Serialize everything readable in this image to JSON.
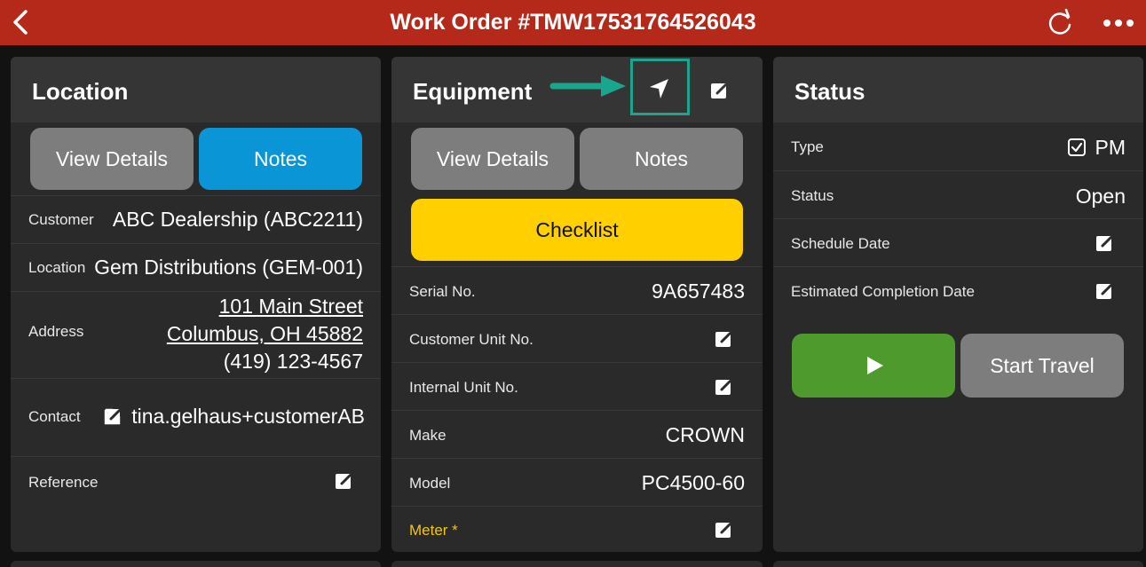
{
  "header": {
    "title": "Work Order #TMW17531764526043",
    "bg_color": "#b5291a"
  },
  "location": {
    "title": "Location",
    "tabs": {
      "details": "View Details",
      "notes": "Notes"
    },
    "customer_label": "Customer",
    "customer_value": "ABC Dealership (ABC2211)",
    "location_label": "Location",
    "location_value": "Gem Distributions (GEM-001)",
    "address_label": "Address",
    "address_line1": "101 Main Street",
    "address_line2": "Columbus, OH 45882",
    "phone": "(419) 123-4567",
    "contact_label": "Contact",
    "contact_value": "tina.gelhaus+customerAB",
    "reference_label": "Reference"
  },
  "equipment": {
    "title": "Equipment",
    "tabs": {
      "details": "View Details",
      "notes": "Notes"
    },
    "checklist": "Checklist",
    "serial_label": "Serial No.",
    "serial_value": "9A657483",
    "cust_unit_label": "Customer Unit No.",
    "internal_unit_label": "Internal Unit No.",
    "make_label": "Make",
    "make_value": "CROWN",
    "model_label": "Model",
    "model_value": "PC4500-60",
    "meter_label": "Meter *"
  },
  "status": {
    "title": "Status",
    "type_label": "Type",
    "type_value": "PM",
    "type_checked": true,
    "status_label": "Status",
    "status_value": "Open",
    "schedule_label": "Schedule Date",
    "est_completion_label": "Estimated Completion Date",
    "start_travel": "Start Travel"
  },
  "colors": {
    "accent_blue": "#0a95d6",
    "checklist_yellow": "#ffcf00",
    "play_green": "#4f9a2d",
    "callout_teal": "#1aa58f",
    "meter_label": "#f0c419"
  },
  "icons": {
    "back": "chevron-left-icon",
    "refresh": "refresh-icon",
    "more": "more-horizontal-icon",
    "navigate": "navigation-arrow-icon",
    "edit": "edit-square-icon",
    "play": "play-icon",
    "checkbox": "checkbox-checked-icon"
  }
}
